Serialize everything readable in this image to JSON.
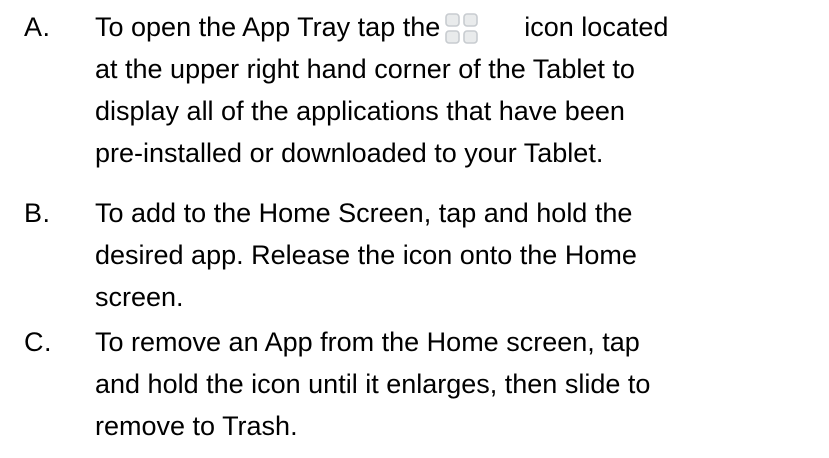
{
  "instructions": {
    "items": [
      {
        "marker": "A.",
        "lines": [
          {
            "before_icon": "To open the App Tray tap the",
            "icon": "app-tray-grid-icon",
            "after_icon": "icon located"
          },
          "at the upper right hand corner of the Tablet to",
          "display all of the applications that have been",
          "pre-installed or downloaded to your Tablet."
        ]
      },
      {
        "marker": "B.",
        "lines": [
          "To add to the Home Screen, tap and hold the",
          "desired app. Release the icon onto the Home",
          "screen."
        ]
      },
      {
        "marker": "C.",
        "lines": [
          "To remove an App from the Home screen, tap",
          "and hold the icon until it enlarges, then slide to",
          "remove to Trash."
        ]
      }
    ]
  },
  "colors": {
    "text": "#000000",
    "background": "#ffffff",
    "icon_fill": "#e9ebec",
    "icon_stroke": "#c8ccd0"
  }
}
